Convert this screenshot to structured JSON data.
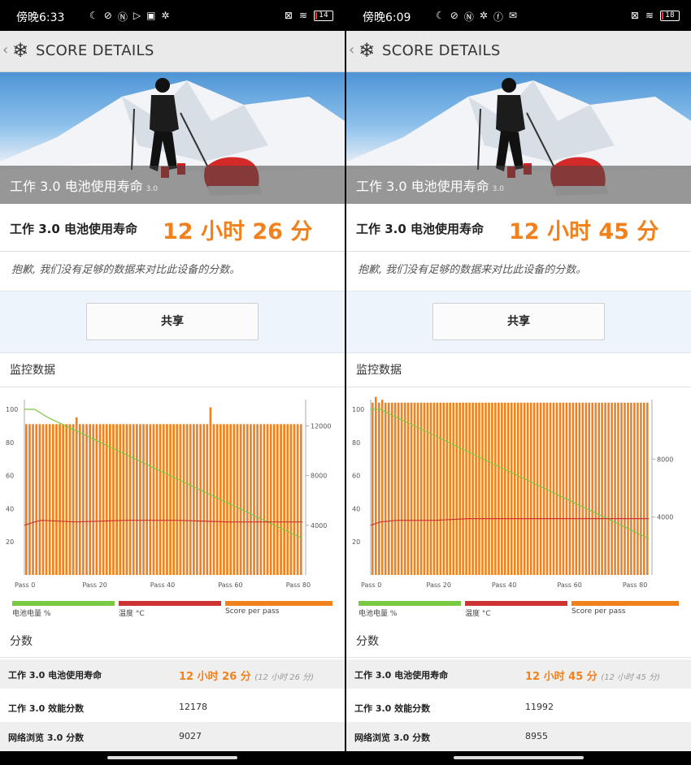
{
  "screens": [
    {
      "status": {
        "time": "傍晚6:33",
        "icons": [
          "moon-icon",
          "no-vibrate-icon",
          "nfc-icon",
          "play-icon",
          "notification-icon",
          "gear-icon"
        ],
        "battery": "14"
      },
      "header": {
        "title": "SCORE DETAILS"
      },
      "hero": {
        "label": "工作 3.0 电池使用寿命",
        "version": "3.0"
      },
      "score": {
        "label": "工作 3.0 电池使用寿命",
        "value": "12 小时 26 分"
      },
      "note": "抱歉, 我们没有足够的数据来对比此设备的分数。",
      "share_label": "共享",
      "monitor_title": "监控数据",
      "chart_data": {
        "type": "bar",
        "title": "",
        "x_ticks": [
          "Pass 0",
          "Pass 20",
          "Pass 40",
          "Pass 60",
          "Pass 80"
        ],
        "left_ticks": [
          "100",
          "80",
          "60",
          "40",
          "20"
        ],
        "right_ticks": [
          "12000",
          "8000",
          "4000"
        ],
        "x_range": [
          0,
          82
        ],
        "left_ylim": [
          0,
          100
        ],
        "right_ylim": [
          0,
          14000
        ],
        "series": [
          {
            "name": "电池电量 %",
            "type": "line",
            "axis": "left",
            "color": "#7ac943",
            "points": [
              [
                0,
                100
              ],
              [
                3,
                100
              ],
              [
                7,
                95
              ],
              [
                82,
                22
              ]
            ]
          },
          {
            "name": "温度 °C",
            "type": "line",
            "axis": "left",
            "color": "#cc3333",
            "points": [
              [
                0,
                30
              ],
              [
                3,
                32
              ],
              [
                5,
                33
              ],
              [
                15,
                32
              ],
              [
                30,
                33
              ],
              [
                45,
                33
              ],
              [
                60,
                32
              ],
              [
                82,
                32
              ]
            ]
          },
          {
            "name": "Score per pass",
            "type": "bar",
            "axis": "right",
            "color": "#f0811d",
            "value": 12150,
            "spikes": [
              [
                15,
                12700
              ],
              [
                55,
                13500
              ]
            ]
          }
        ]
      },
      "legend": [
        {
          "label": "电池电量 %",
          "color": "#7ac943"
        },
        {
          "label": "温度 °C",
          "color": "#cc3333"
        },
        {
          "label": "Score per pass",
          "color": "#f0811d"
        }
      ],
      "scores_title": "分数",
      "table": [
        {
          "k": "工作 3.0 电池使用寿命",
          "v": "12 小时 26 分",
          "sub": "(12 小时 26 分)"
        },
        {
          "k": "工作 3.0 效能分数",
          "v": "12178"
        },
        {
          "k": "网络浏览 3.0 分数",
          "v": "9027"
        }
      ]
    },
    {
      "status": {
        "time": "傍晚6:09",
        "icons": [
          "moon-icon",
          "no-vibrate-icon",
          "nfc-icon",
          "gear-icon",
          "facebook-icon",
          "mail-icon"
        ],
        "battery": "18"
      },
      "header": {
        "title": "SCORE DETAILS"
      },
      "hero": {
        "label": "工作 3.0 电池使用寿命",
        "version": "3.0"
      },
      "score": {
        "label": "工作 3.0 电池使用寿命",
        "value": "12 小时 45 分"
      },
      "note": "抱歉, 我们没有足够的数据来对比此设备的分数。",
      "share_label": "共享",
      "monitor_title": "监控数据",
      "chart_data": {
        "type": "bar",
        "title": "",
        "x_ticks": [
          "Pass 0",
          "Pass 20",
          "Pass 40",
          "Pass 60",
          "Pass 80"
        ],
        "left_ticks": [
          "100",
          "80",
          "60",
          "40",
          "20"
        ],
        "right_ticks": [
          "8000",
          "4000"
        ],
        "x_range": [
          0,
          85
        ],
        "left_ylim": [
          0,
          100
        ],
        "right_ylim": [
          0,
          12000
        ],
        "series": [
          {
            "name": "电池电量 %",
            "type": "line",
            "axis": "left",
            "color": "#7ac943",
            "points": [
              [
                0,
                100
              ],
              [
                3,
                100
              ],
              [
                7,
                96
              ],
              [
                85,
                22
              ]
            ]
          },
          {
            "name": "温度 °C",
            "type": "line",
            "axis": "left",
            "color": "#cc3333",
            "points": [
              [
                0,
                30
              ],
              [
                3,
                32
              ],
              [
                8,
                33
              ],
              [
                20,
                33
              ],
              [
                30,
                34
              ],
              [
                85,
                34
              ]
            ]
          },
          {
            "name": "Score per pass",
            "type": "bar",
            "axis": "right",
            "color": "#f0811d",
            "value": 11900,
            "spikes": [
              [
                1,
                12300
              ],
              [
                3,
                12100
              ]
            ]
          }
        ]
      },
      "legend": [
        {
          "label": "电池电量 %",
          "color": "#7ac943"
        },
        {
          "label": "温度 °C",
          "color": "#cc3333"
        },
        {
          "label": "Score per pass",
          "color": "#f0811d"
        }
      ],
      "scores_title": "分数",
      "table": [
        {
          "k": "工作 3.0 电池使用寿命",
          "v": "12 小时 45 分",
          "sub": "(12 小时 45 分)"
        },
        {
          "k": "工作 3.0 效能分数",
          "v": "11992"
        },
        {
          "k": "网络浏览 3.0 分数",
          "v": "8955"
        }
      ]
    }
  ]
}
